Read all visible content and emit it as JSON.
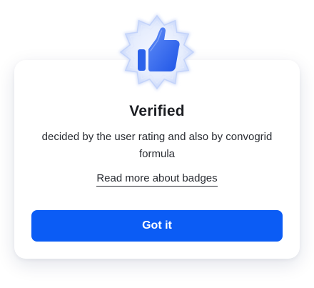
{
  "badge": {
    "icon": "thumbs-up-icon",
    "colors": {
      "accent": "#1f55e6",
      "accent_light": "#5f8cf7",
      "glow": "#dbe5fd"
    }
  },
  "dialog": {
    "title": "Verified",
    "description": "decided by the user rating and also by convogrid formula",
    "link_text": "Read more about badges",
    "button_label": "Got it",
    "button_color": "#0b5cf5"
  }
}
